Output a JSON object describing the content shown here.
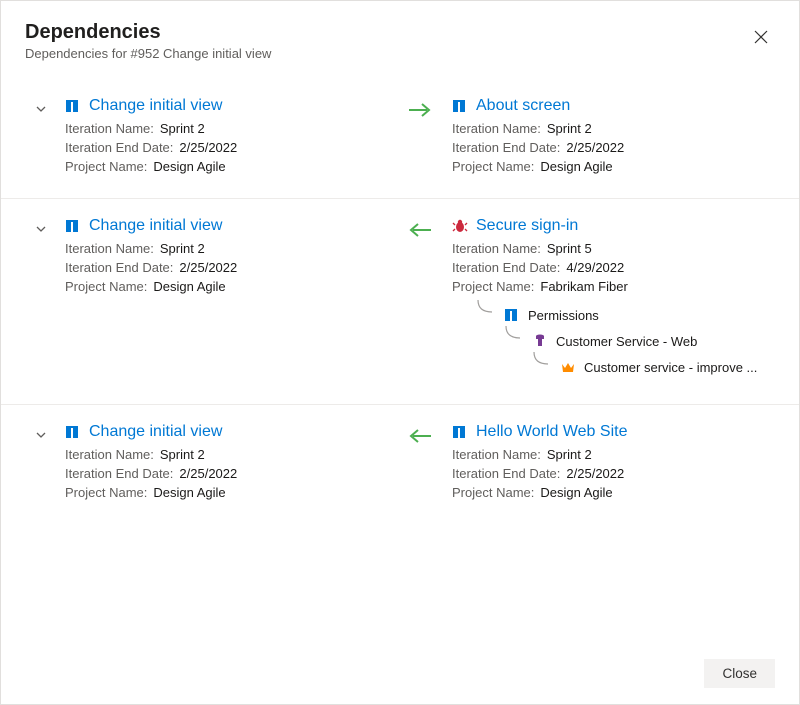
{
  "header": {
    "title": "Dependencies",
    "subtitle": "Dependencies for #952 Change initial view"
  },
  "labels": {
    "iteration_name": "Iteration Name:",
    "iteration_end": "Iteration End Date:",
    "project_name": "Project Name:"
  },
  "rows": [
    {
      "direction": "right",
      "left": {
        "icon": "feature-icon",
        "icon_color": "#0078d4",
        "title": "Change initial view",
        "iteration_name": "Sprint 2",
        "iteration_end": "2/25/2022",
        "project_name": "Design Agile"
      },
      "right": {
        "icon": "feature-icon",
        "icon_color": "#0078d4",
        "title": "About screen",
        "iteration_name": "Sprint 2",
        "iteration_end": "2/25/2022",
        "project_name": "Design Agile"
      }
    },
    {
      "direction": "left",
      "left": {
        "icon": "feature-icon",
        "icon_color": "#0078d4",
        "title": "Change initial view",
        "iteration_name": "Sprint 2",
        "iteration_end": "2/25/2022",
        "project_name": "Design Agile"
      },
      "right": {
        "icon": "bug-icon",
        "icon_color": "#cc293d",
        "title": "Secure sign-in",
        "iteration_name": "Sprint 5",
        "iteration_end": "4/29/2022",
        "project_name": "Fabrikam Fiber",
        "children": [
          {
            "icon": "feature-icon",
            "icon_color": "#0078d4",
            "label": "Permissions",
            "indent": 0
          },
          {
            "icon": "epic-icon",
            "icon_color": "#773b93",
            "label": "Customer Service - Web",
            "indent": 1
          },
          {
            "icon": "crown-icon",
            "icon_color": "#ff8c00",
            "label": "Customer service - improve ...",
            "indent": 2
          }
        ]
      }
    },
    {
      "direction": "left",
      "left": {
        "icon": "feature-icon",
        "icon_color": "#0078d4",
        "title": "Change initial view",
        "iteration_name": "Sprint 2",
        "iteration_end": "2/25/2022",
        "project_name": "Design Agile"
      },
      "right": {
        "icon": "feature-icon",
        "icon_color": "#0078d4",
        "title": "Hello World Web Site",
        "iteration_name": "Sprint 2",
        "iteration_end": "2/25/2022",
        "project_name": "Design Agile"
      }
    }
  ],
  "footer": {
    "close_label": "Close"
  },
  "colors": {
    "link": "#0078d4",
    "arrow_green": "#4caf50"
  }
}
